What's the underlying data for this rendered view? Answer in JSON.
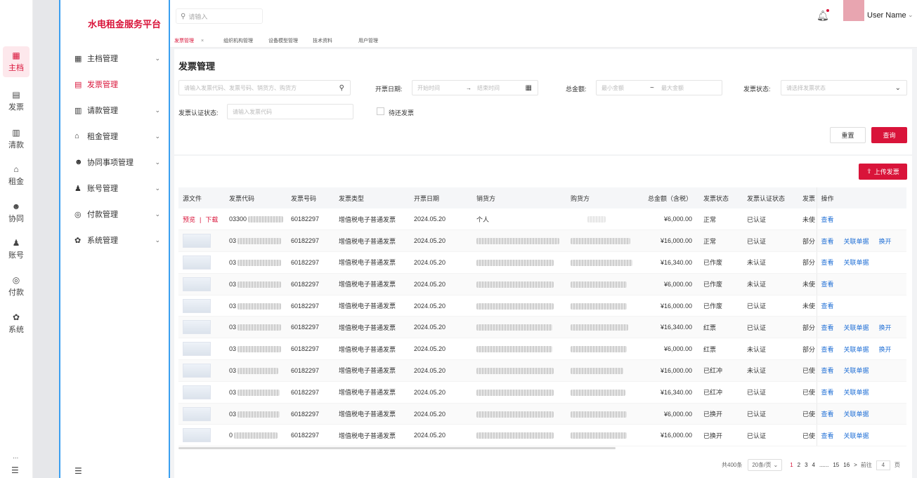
{
  "rail": {
    "items": [
      {
        "icon": "grid-icon",
        "glyph": "▦",
        "label": "主档",
        "active": true
      },
      {
        "icon": "invoice-icon",
        "glyph": "▤",
        "label": "发票"
      },
      {
        "icon": "clipboard-icon",
        "glyph": "▥",
        "label": "清款"
      },
      {
        "icon": "house-icon",
        "glyph": "⌂",
        "label": "租金"
      },
      {
        "icon": "people-icon",
        "glyph": "☻",
        "label": "协同"
      },
      {
        "icon": "user-icon",
        "glyph": "♟",
        "label": "账号"
      },
      {
        "icon": "payment-icon",
        "glyph": "◎",
        "label": "付款"
      },
      {
        "icon": "gear-icon",
        "glyph": "✿",
        "label": "系统"
      }
    ],
    "more": "...",
    "collapse_glyph": "☰"
  },
  "sidebar": {
    "brand": "水电租金服务平台",
    "items": [
      {
        "icon": "grid-icon",
        "glyph": "▦",
        "label": "主档管理",
        "chevron": true
      },
      {
        "icon": "invoice-icon",
        "glyph": "▤",
        "label": "发票管理",
        "chevron": false,
        "active": true
      },
      {
        "icon": "clipboard-icon",
        "glyph": "▥",
        "label": "请款管理",
        "chevron": true
      },
      {
        "icon": "house-icon",
        "glyph": "⌂",
        "label": "租金管理",
        "chevron": true
      },
      {
        "icon": "people-icon",
        "glyph": "☻",
        "label": "协同事项管理",
        "chevron": true
      },
      {
        "icon": "user-icon",
        "glyph": "♟",
        "label": "账号管理",
        "chevron": true
      },
      {
        "icon": "payment-icon",
        "glyph": "◎",
        "label": "付款管理",
        "chevron": true
      },
      {
        "icon": "gear-icon",
        "glyph": "✿",
        "label": "系统管理",
        "chevron": true
      }
    ],
    "collapse_glyph": "☰"
  },
  "topbar": {
    "search_placeholder": "请输入",
    "user_name": "User Name"
  },
  "tabs": [
    {
      "label": "发票管理",
      "active": true,
      "closable": true
    },
    {
      "label": "组织机构管理"
    },
    {
      "label": "设备模型管理"
    },
    {
      "label": "技术资料"
    },
    {
      "label": "用户管理"
    }
  ],
  "filters": {
    "page_title": "发票管理",
    "keyword_placeholder": "请输入发票代码、发票号码、销货方、购货方",
    "date_label": "开票日期:",
    "date_start": "开始时间",
    "date_end": "结束时间",
    "amount_label": "总金额:",
    "amount_min": "最小金额",
    "amount_sep": "~",
    "amount_max": "最大金额",
    "status_label": "发票状态:",
    "status_placeholder": "请选择发票状态",
    "cert_label": "发票认证状态:",
    "cert_placeholder": "请输入发票代码",
    "pending_label": "待还发票",
    "reset": "重置",
    "query": "查询"
  },
  "table": {
    "upload": "上传发票",
    "headers": [
      "源文件",
      "发票代码",
      "发票号码",
      "发票类型",
      "开票日期",
      "销货方",
      "购货方",
      "总金额（含税）",
      "发票状态",
      "发票认证状态",
      "发票",
      "操作"
    ],
    "rows": [
      {
        "code": "03300",
        "no": "60182297",
        "type": "增值税电子普通发票",
        "date": "2024.05.20",
        "seller": "个人",
        "amount": "¥6,000.00",
        "status": "正常",
        "cert": "已认证",
        "use": "未使",
        "actions": [
          "查看"
        ]
      },
      {
        "code": "03",
        "no": "60182297",
        "type": "增值税电子普通发票",
        "date": "2024.05.20",
        "seller": "",
        "amount": "¥16,000.00",
        "status": "正常",
        "cert": "已认证",
        "use": "部分",
        "actions": [
          "查看",
          "关联单据",
          "换开"
        ]
      },
      {
        "code": "03",
        "no": "60182297",
        "type": "增值税电子普通发票",
        "date": "2024.05.20",
        "seller": "",
        "amount": "¥16,340.00",
        "status": "已作废",
        "cert": "未认证",
        "use": "部分",
        "actions": [
          "查看",
          "关联单据"
        ]
      },
      {
        "code": "03",
        "no": "60182297",
        "type": "增值税电子普通发票",
        "date": "2024.05.20",
        "seller": "",
        "amount": "¥6,000.00",
        "status": "已作废",
        "cert": "未认证",
        "use": "未使",
        "actions": [
          "查看"
        ]
      },
      {
        "code": "03",
        "no": "60182297",
        "type": "增值税电子普通发票",
        "date": "2024.05.20",
        "seller": "",
        "amount": "¥16,000.00",
        "status": "已作废",
        "cert": "已认证",
        "use": "未使",
        "actions": [
          "查看"
        ]
      },
      {
        "code": "03",
        "no": "60182297",
        "type": "增值税电子普通发票",
        "date": "2024.05.20",
        "seller": "",
        "amount": "¥16,340.00",
        "status": "红票",
        "cert": "已认证",
        "use": "部分",
        "actions": [
          "查看",
          "关联单据",
          "换开"
        ]
      },
      {
        "code": "03",
        "no": "60182297",
        "type": "增值税电子普通发票",
        "date": "2024.05.20",
        "seller": "",
        "amount": "¥6,000.00",
        "status": "红票",
        "cert": "未认证",
        "use": "部分",
        "actions": [
          "查看",
          "关联单据",
          "换开"
        ]
      },
      {
        "code": "03",
        "no": "60182297",
        "type": "增值税电子普通发票",
        "date": "2024.05.20",
        "seller": "",
        "amount": "¥16,000.00",
        "status": "已红冲",
        "cert": "未认证",
        "use": "已使",
        "actions": [
          "查看",
          "关联单据"
        ]
      },
      {
        "code": "03",
        "no": "60182297",
        "type": "增值税电子普通发票",
        "date": "2024.05.20",
        "seller": "",
        "amount": "¥16,340.00",
        "status": "已红冲",
        "cert": "已认证",
        "use": "已使",
        "actions": [
          "查看",
          "关联单据"
        ]
      },
      {
        "code": "03",
        "no": "60182297",
        "type": "增值税电子普通发票",
        "date": "2024.05.20",
        "seller": "",
        "amount": "¥6,000.00",
        "status": "已换开",
        "cert": "已认证",
        "use": "已使",
        "actions": [
          "查看",
          "关联单据"
        ]
      },
      {
        "code": "0",
        "no": "60182297",
        "type": "增值税电子普通发票",
        "date": "2024.05.20",
        "seller": "",
        "amount": "¥16,000.00",
        "status": "已换开",
        "cert": "已认证",
        "use": "已使",
        "actions": [
          "查看",
          "关联单据"
        ]
      }
    ],
    "row0_file_actions": [
      "预览",
      "下载"
    ]
  },
  "pager": {
    "total": "共400条",
    "size": "20条/页",
    "pages": [
      "1",
      "2",
      "3",
      "4",
      "......",
      "15",
      "16"
    ],
    "next": ">",
    "goto_label": "前往",
    "goto_value": "4",
    "page_suffix": "页"
  }
}
